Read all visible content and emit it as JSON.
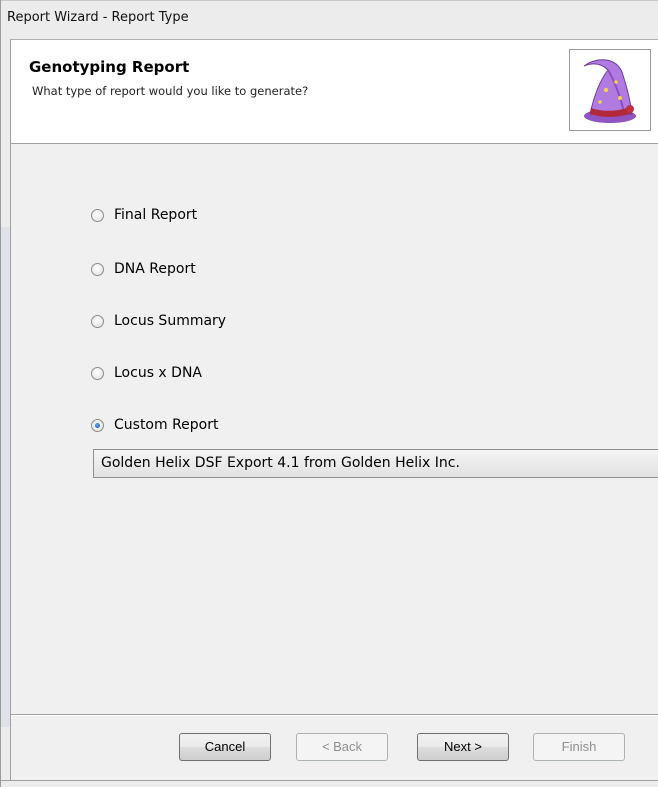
{
  "window": {
    "title": "Report Wizard - Report Type"
  },
  "header": {
    "heading": "Genotyping Report",
    "subheading": "What type of report would you like to generate?",
    "image_icon": "wizard-hat-icon"
  },
  "report_types": [
    {
      "label": "Final Report",
      "checked": false
    },
    {
      "label": "DNA Report",
      "checked": false
    },
    {
      "label": "Locus Summary",
      "checked": false
    },
    {
      "label": "Locus x DNA",
      "checked": false
    },
    {
      "label": "Custom Report",
      "checked": true
    }
  ],
  "custom_report_select": {
    "value": "Golden Helix DSF Export 4.1 from Golden Helix Inc."
  },
  "buttons": {
    "cancel": "Cancel",
    "back": "< Back",
    "next": "Next >",
    "finish": "Finish"
  },
  "colors": {
    "radio_selected": "#1f5fb8",
    "hat": "#a66bd6",
    "hat_band": "#b02a3a"
  }
}
